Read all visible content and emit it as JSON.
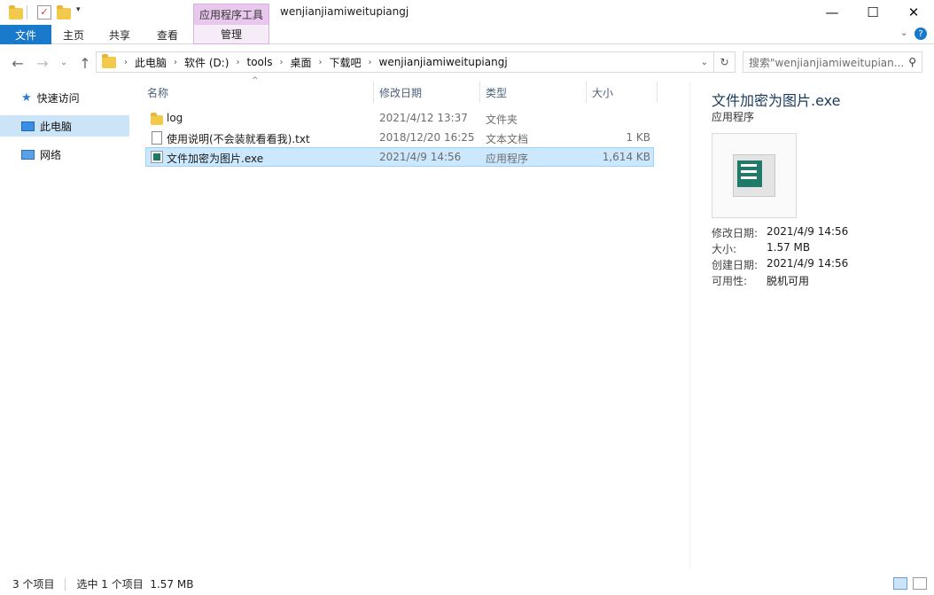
{
  "window": {
    "title": "wenjianjiamiweitupiangj",
    "context_tab_group": "应用程序工具",
    "controls": [
      "—",
      "☐",
      "✕"
    ]
  },
  "ribbon": {
    "tabs": [
      "文件",
      "主页",
      "共享",
      "查看",
      "管理"
    ]
  },
  "address": {
    "crumbs": [
      "此电脑",
      "软件 (D:)",
      "tools",
      "桌面",
      "下载吧",
      "wenjianjiamiweitupiangj"
    ],
    "search_placeholder": "搜索\"wenjianjiamiweitupian..."
  },
  "nav": {
    "items": [
      {
        "label": "快速访问",
        "icon": "star-icon"
      },
      {
        "label": "此电脑",
        "icon": "computer-icon",
        "selected": true
      },
      {
        "label": "网络",
        "icon": "network-icon"
      }
    ]
  },
  "columns": [
    "名称",
    "修改日期",
    "类型",
    "大小"
  ],
  "files": [
    {
      "name": "log",
      "date": "2021/4/12 13:37",
      "type": "文件夹",
      "size": "",
      "icon": "folder-icon"
    },
    {
      "name": "使用说明(不会装就看看我).txt",
      "date": "2018/12/20 16:25",
      "type": "文本文档",
      "size": "1 KB",
      "icon": "text-file-icon"
    },
    {
      "name": "文件加密为图片.exe",
      "date": "2021/4/9 14:56",
      "type": "应用程序",
      "size": "1,614 KB",
      "icon": "exe-icon",
      "selected": true
    }
  ],
  "preview": {
    "title": "文件加密为图片.exe",
    "subtitle": "应用程序",
    "props": [
      {
        "label": "修改日期:",
        "value": "2021/4/9 14:56"
      },
      {
        "label": "大小:",
        "value": "1.57 MB"
      },
      {
        "label": "创建日期:",
        "value": "2021/4/9 14:56"
      },
      {
        "label": "可用性:",
        "value": "脱机可用"
      }
    ]
  },
  "status": {
    "count": "3 个项目",
    "selection": "选中 1 个项目  1.57 MB"
  },
  "colors": {
    "accent": "#1979ca",
    "selection": "#cce8ff",
    "context_tab": "#e8c8ec"
  }
}
